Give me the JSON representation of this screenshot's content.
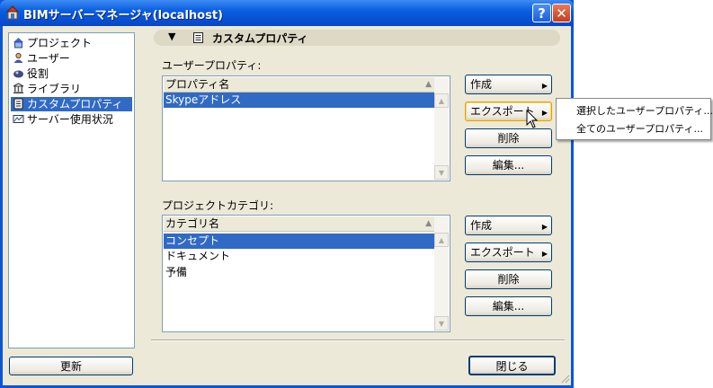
{
  "window": {
    "title": "BIMサーバーマネージャ(localhost)",
    "help_label": "?",
    "close_label": "✕"
  },
  "sidebar": {
    "items": [
      {
        "label": "プロジェクト",
        "icon": "project-icon",
        "selected": false
      },
      {
        "label": "ユーザー",
        "icon": "user-icon",
        "selected": false
      },
      {
        "label": "役割",
        "icon": "role-icon",
        "selected": false
      },
      {
        "label": "ライブラリ",
        "icon": "library-icon",
        "selected": false
      },
      {
        "label": "カスタムプロパティ",
        "icon": "custom-property-icon",
        "selected": true
      },
      {
        "label": "サーバー使用状況",
        "icon": "server-usage-icon",
        "selected": false
      }
    ],
    "refresh_label": "更新"
  },
  "header": {
    "collapse_glyph": "▼",
    "title": "カスタムプロパティ"
  },
  "user_properties": {
    "label": "ユーザープロパティ:",
    "column": "プロパティ名",
    "rows": [
      "Skypeアドレス"
    ],
    "selected_index": 0,
    "buttons": {
      "create": "作成",
      "export": "エクスポート",
      "delete": "削除",
      "edit": "編集..."
    }
  },
  "project_categories": {
    "label": "プロジェクトカテゴリ:",
    "column": "カテゴリ名",
    "rows": [
      "コンセプト",
      "ドキュメント",
      "予備"
    ],
    "selected_index": 0,
    "buttons": {
      "create": "作成",
      "export": "エクスポート",
      "delete": "削除",
      "edit": "編集..."
    }
  },
  "footer": {
    "close_label": "閉じる"
  },
  "export_menu": {
    "items": [
      "選択したユーザープロパティ...",
      "全てのユーザープロパティ..."
    ]
  },
  "colors": {
    "titlebar": "#0a5fe0",
    "selection": "#316ac5",
    "dialog_bg": "#ece9d8"
  }
}
